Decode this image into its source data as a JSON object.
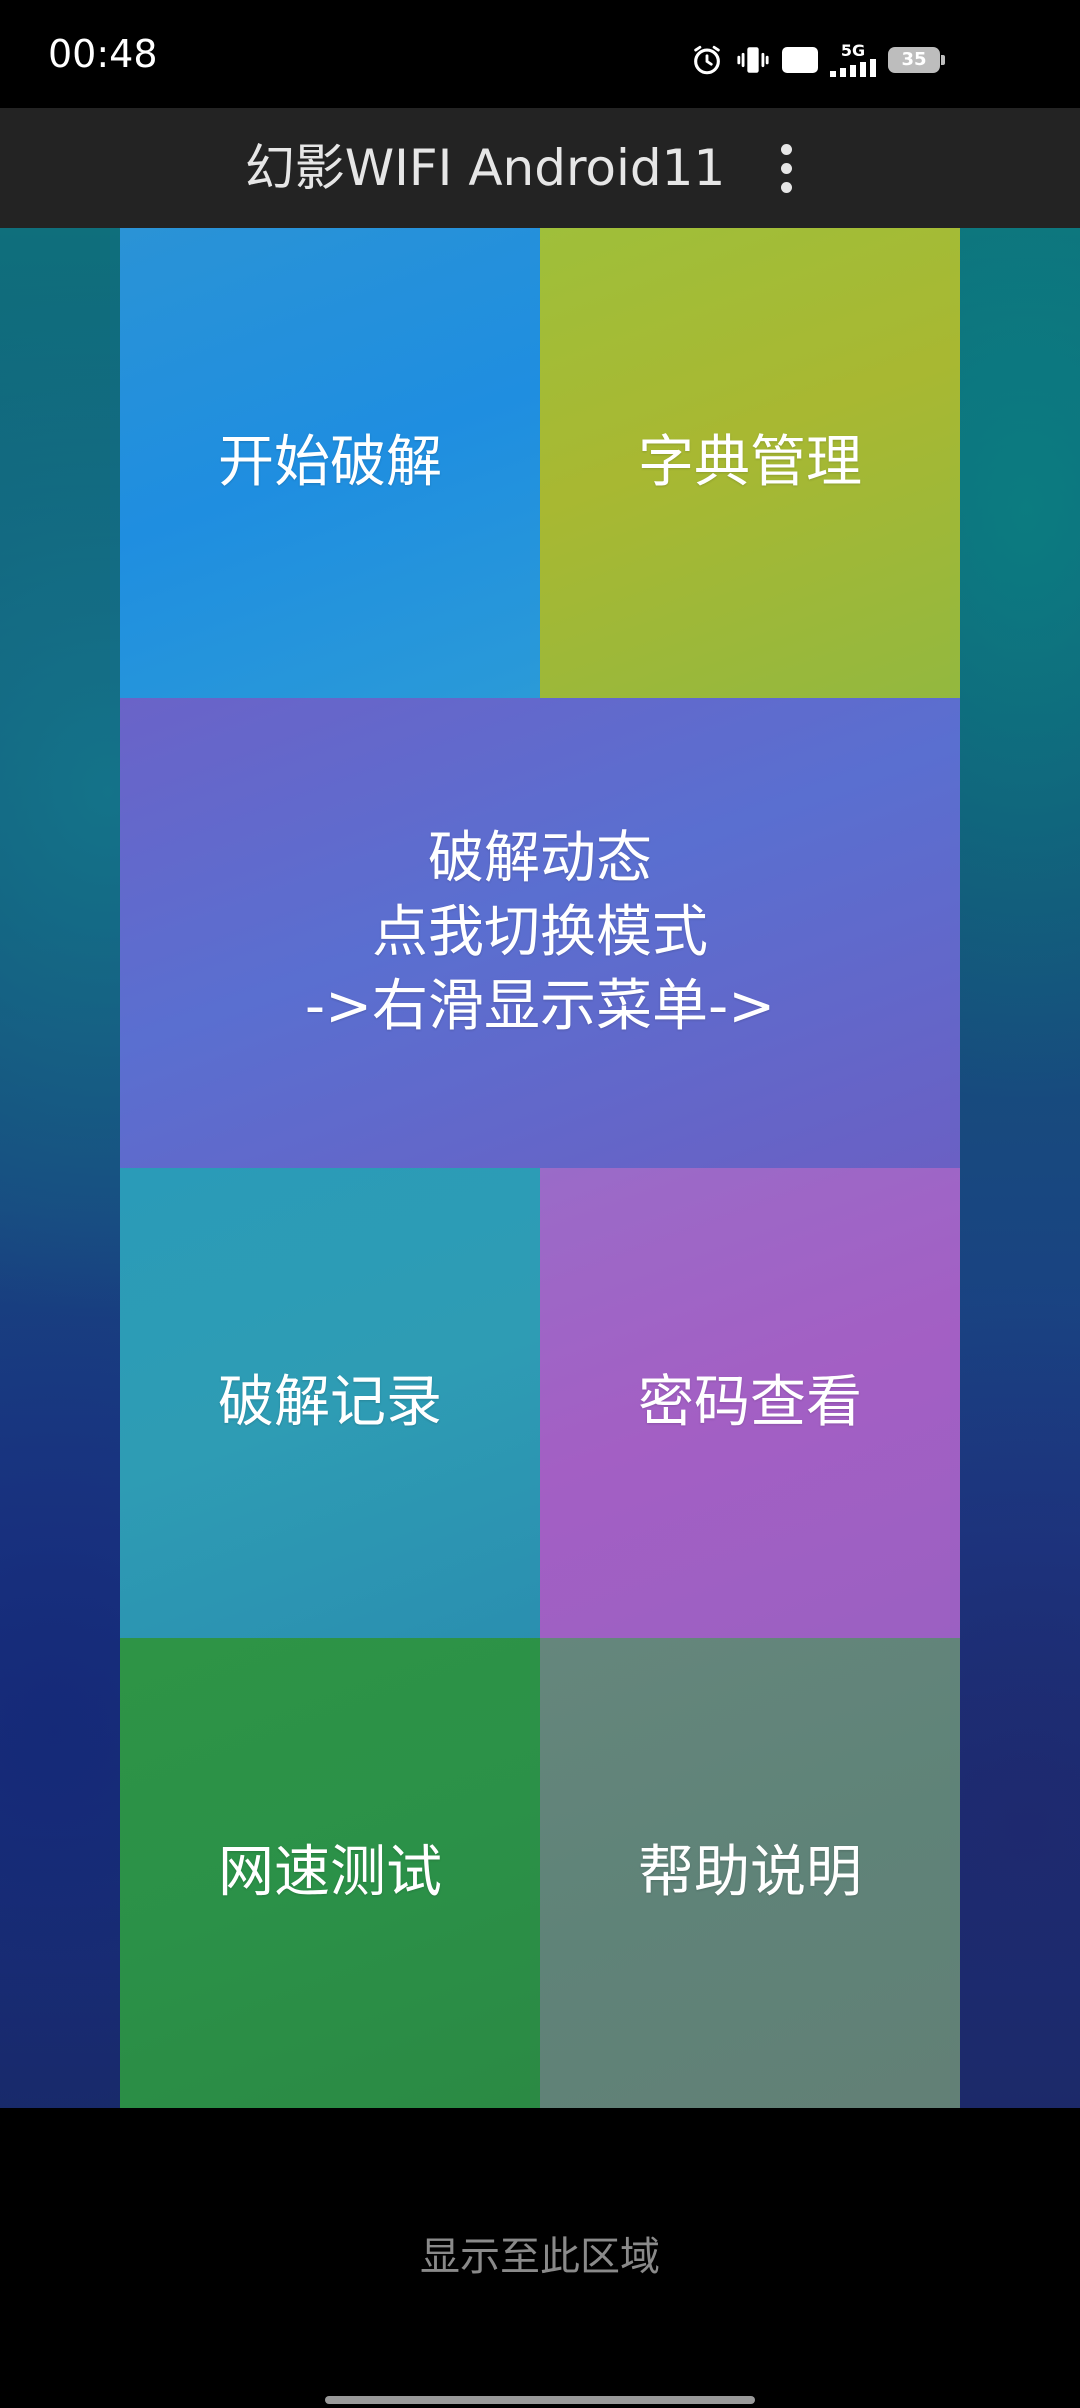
{
  "status_bar": {
    "time": "00:48",
    "icons": [
      "alarm-icon",
      "vibrate-icon",
      "hd-icon",
      "signal-5g-icon",
      "battery-icon"
    ],
    "hd_label": "HD",
    "network_label": "5G",
    "battery_level": "35"
  },
  "app_bar": {
    "title": "幻影WIFI Android11",
    "menu_icon": "more-vert-icon"
  },
  "tiles": {
    "start_crack": "开始破解",
    "dict_manage": "字典管理",
    "dynamic": {
      "line1": "破解动态",
      "line2": "点我切换模式",
      "line3": "->右滑显示菜单->"
    },
    "crack_records": "破解记录",
    "password_view": "密码查看",
    "speed_test": "网速测试",
    "help": "帮助说明"
  },
  "bottom": {
    "hint": "显示至此区域"
  },
  "colors": {
    "tile_start": "#2a93d6",
    "tile_dict": "#a2ba36",
    "tile_dynamic": "#6068cc",
    "tile_records": "#2d9bb6",
    "tile_password": "#a062c4",
    "tile_speed": "#2c9047",
    "tile_help": "#62847a",
    "app_bar": "#232323"
  }
}
